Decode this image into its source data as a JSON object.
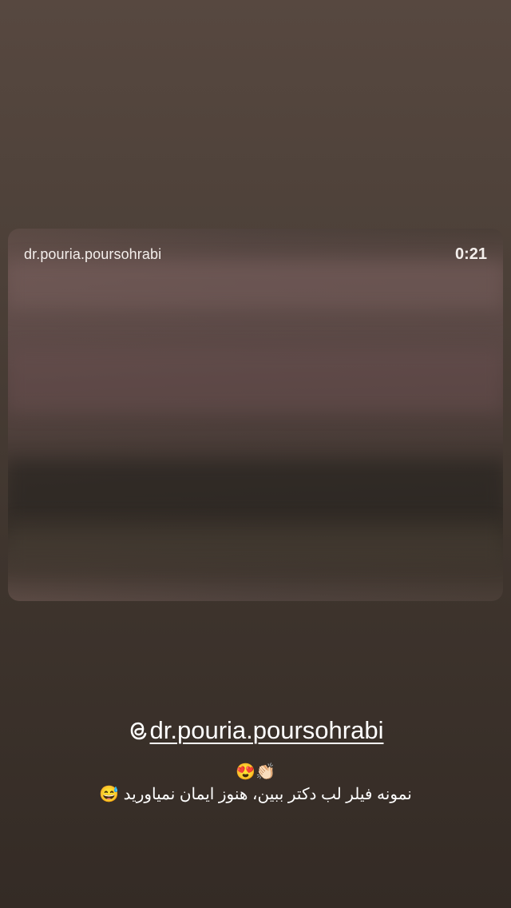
{
  "video": {
    "username": "dr.pouria.poursohrabi",
    "duration": "0:21"
  },
  "mention": {
    "text": "dr.pouria.poursohrabi",
    "icon": "threads-icon"
  },
  "caption": {
    "line1": "😍👏🏻",
    "line2": "نمونه فیلر لب دکتر ببین، هنوز ایمان نمیاورید 😅"
  }
}
